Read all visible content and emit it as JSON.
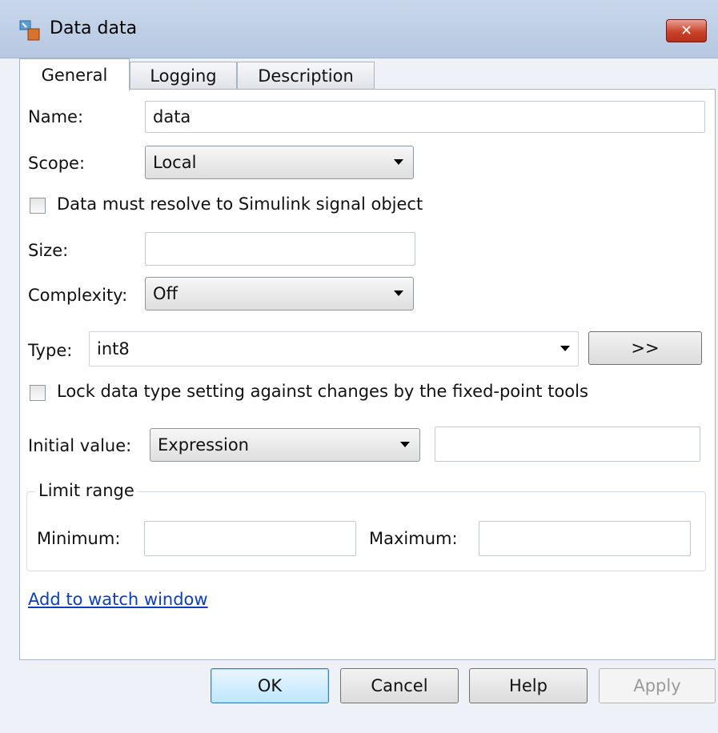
{
  "window": {
    "title": "Data data",
    "icon": "simulink-data-icon",
    "close_icon": "close-icon"
  },
  "tabs": [
    {
      "label": "General",
      "active": true
    },
    {
      "label": "Logging",
      "active": false
    },
    {
      "label": "Description",
      "active": false
    }
  ],
  "general": {
    "name_label": "Name:",
    "name_value": "data",
    "scope_label": "Scope:",
    "scope_value": "Local",
    "resolve_label": "Data must resolve to Simulink signal object",
    "resolve_checked": false,
    "size_label": "Size:",
    "size_value": "",
    "complexity_label": "Complexity:",
    "complexity_value": "Off",
    "type_label": "Type:",
    "type_value": "int8",
    "type_assistant_label": ">>",
    "lock_label": "Lock data type setting against changes by the fixed-point tools",
    "lock_checked": false,
    "initial_label": "Initial value:",
    "initial_mode": "Expression",
    "initial_value": "",
    "limit_group_label": "Limit range",
    "minimum_label": "Minimum:",
    "minimum_value": "",
    "maximum_label": "Maximum:",
    "maximum_value": "",
    "watch_link": "Add to watch window"
  },
  "buttons": {
    "ok": "OK",
    "cancel": "Cancel",
    "help": "Help",
    "apply": "Apply"
  }
}
